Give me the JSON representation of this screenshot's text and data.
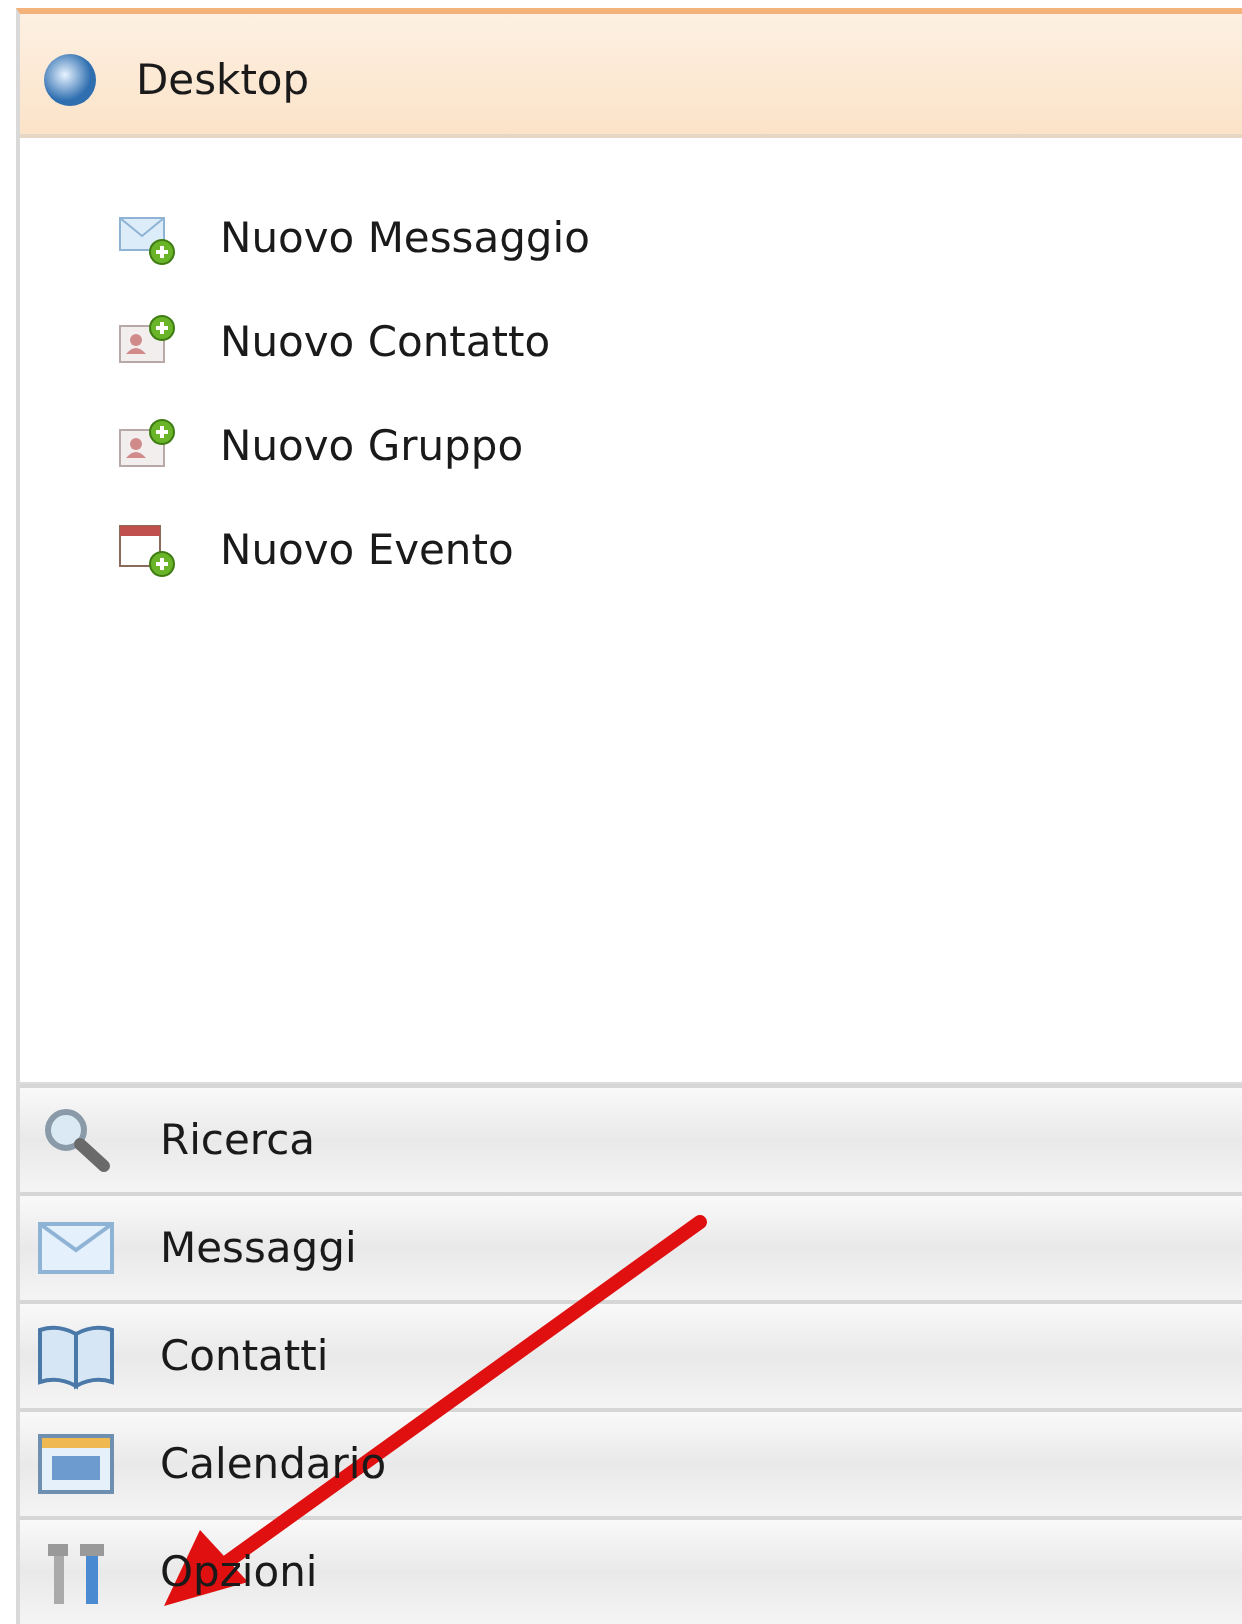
{
  "panel": {
    "title": "Desktop",
    "expanded": true,
    "items": [
      {
        "label": "Nuovo Messaggio",
        "kind": "message"
      },
      {
        "label": "Nuovo Contatto",
        "kind": "contact"
      },
      {
        "label": "Nuovo Gruppo",
        "kind": "group"
      },
      {
        "label": "Nuovo Evento",
        "kind": "event"
      }
    ]
  },
  "sections": [
    {
      "label": "Ricerca",
      "kind": "search"
    },
    {
      "label": "Messaggi",
      "kind": "messages"
    },
    {
      "label": "Contatti",
      "kind": "contacts"
    },
    {
      "label": "Calendario",
      "kind": "calendar"
    },
    {
      "label": "Opzioni",
      "kind": "options"
    }
  ]
}
